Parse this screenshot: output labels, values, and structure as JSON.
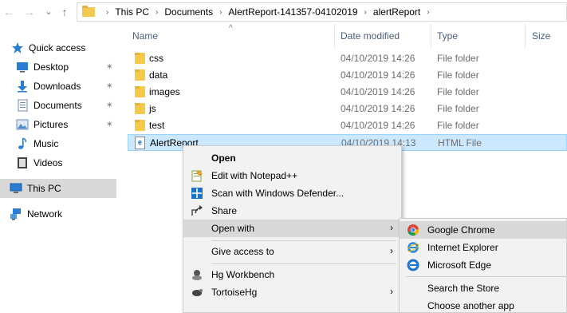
{
  "address": {
    "crumbs": [
      "This PC",
      "Documents",
      "AlertReport-141357-04102019",
      "alertReport"
    ]
  },
  "nav_buttons": {
    "back": "←",
    "forward": "→",
    "recent": "⌄",
    "up": "↑",
    "crumb_sep": "›"
  },
  "nav": {
    "items": [
      {
        "label": "Quick access",
        "icon": "star-icon",
        "pinned": false
      },
      {
        "label": "Desktop",
        "icon": "desktop-icon",
        "pinned": true
      },
      {
        "label": "Downloads",
        "icon": "download-icon",
        "pinned": true
      },
      {
        "label": "Documents",
        "icon": "documents-icon",
        "pinned": true
      },
      {
        "label": "Pictures",
        "icon": "pictures-icon",
        "pinned": true
      },
      {
        "label": "Music",
        "icon": "music-icon",
        "pinned": false
      },
      {
        "label": "Videos",
        "icon": "videos-icon",
        "pinned": false
      },
      {
        "label": "This PC",
        "icon": "this-pc-icon",
        "pinned": false
      },
      {
        "label": "Network",
        "icon": "network-icon",
        "pinned": false
      }
    ]
  },
  "columns": {
    "name": "Name",
    "date": "Date modified",
    "type": "Type",
    "size": "Size",
    "sort_glyph": "^"
  },
  "files": [
    {
      "name": "css",
      "date": "04/10/2019 14:26",
      "type": "File folder",
      "kind": "folder"
    },
    {
      "name": "data",
      "date": "04/10/2019 14:26",
      "type": "File folder",
      "kind": "folder"
    },
    {
      "name": "images",
      "date": "04/10/2019 14:26",
      "type": "File folder",
      "kind": "folder"
    },
    {
      "name": "js",
      "date": "04/10/2019 14:26",
      "type": "File folder",
      "kind": "folder"
    },
    {
      "name": "test",
      "date": "04/10/2019 14:26",
      "type": "File folder",
      "kind": "folder"
    },
    {
      "name": "AlertReport",
      "date": "04/10/2019 14:13",
      "type": "HTML File",
      "kind": "html"
    }
  ],
  "context_menu": {
    "items": {
      "open": "Open",
      "edit_notepad": "Edit with Notepad++",
      "scan_defender": "Scan with Windows Defender...",
      "share": "Share",
      "open_with": "Open with",
      "give_access": "Give access to",
      "hg_workbench": "Hg Workbench",
      "tortoisehg": "TortoiseHg"
    },
    "arrow": "›"
  },
  "open_with_menu": {
    "chrome": "Google Chrome",
    "ie": "Internet Explorer",
    "edge": "Microsoft Edge",
    "store": "Search the Store",
    "another": "Choose another app"
  },
  "colors": {
    "selection": "#cce8ff",
    "folder": "#f5c94a",
    "header_text": "#4c607a",
    "menu_bg": "#f2f2f2"
  }
}
